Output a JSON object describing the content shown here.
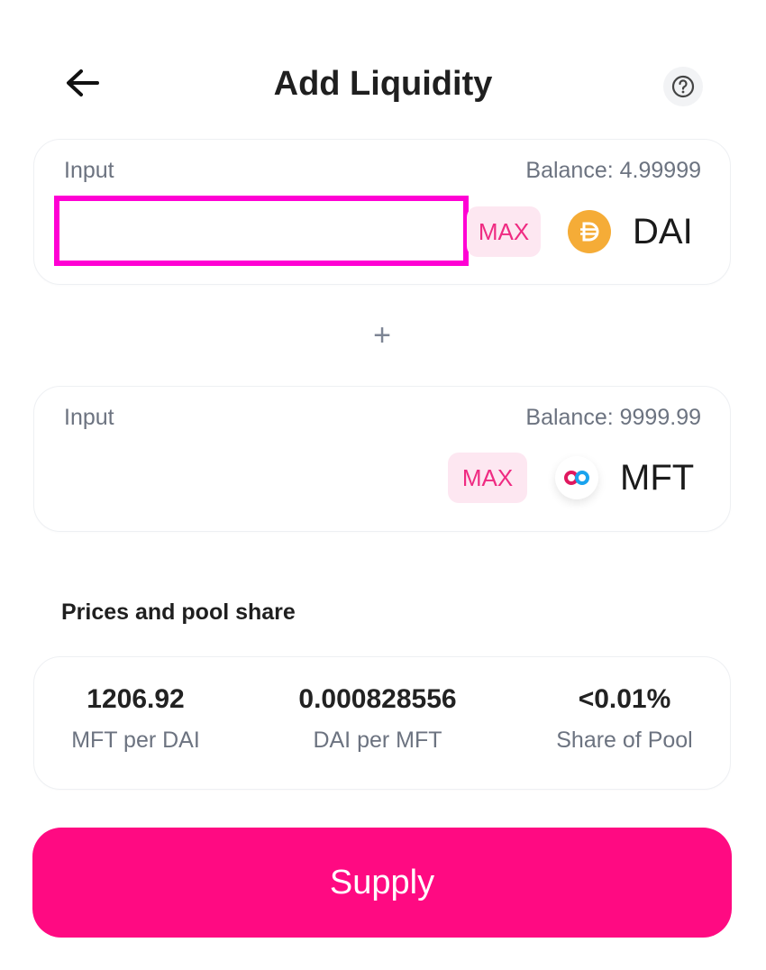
{
  "header": {
    "title": "Add Liquidity"
  },
  "input_a": {
    "label": "Input",
    "balance": "Balance: 4.99999",
    "value": "",
    "placeholder": "",
    "max_label": "MAX",
    "token": "DAI"
  },
  "separator": "+",
  "input_b": {
    "label": "Input",
    "balance": "Balance: 9999.99",
    "max_label": "MAX",
    "token": "MFT"
  },
  "prices": {
    "title": "Prices and pool share",
    "stats": [
      {
        "value": "1206.92",
        "label": "MFT per DAI"
      },
      {
        "value": "0.000828556",
        "label": "DAI per MFT"
      },
      {
        "value": "<0.01%",
        "label": "Share of Pool"
      }
    ]
  },
  "supply_label": "Supply",
  "colors": {
    "accent": "#ff0a82",
    "max_bg": "#fde7f1",
    "max_text": "#ef2b82",
    "dai": "#f5ac37",
    "focus": "#ff00d4"
  }
}
